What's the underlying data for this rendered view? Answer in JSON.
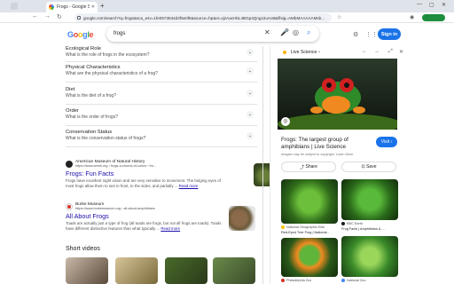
{
  "browser": {
    "tab_title": "Frogs - Google Search",
    "url": "google.com/search?q=frogs&sca_esv=1fe0573534d2f5e0f8&source=hp&ei=xjzAacHbL4BGp4Qngz2uAo8&iflsig=AMbMAAAAAMsb..."
  },
  "header": {
    "query": "frogs",
    "signin_label": "Sign in"
  },
  "paa": [
    {
      "title": "Ecological Role",
      "sub": "What is the role of frogs in the ecosystem?"
    },
    {
      "title": "Physical Characteristics",
      "sub": "What are the physical characteristics of a frog?"
    },
    {
      "title": "Diet",
      "sub": "What is the diet of a frog?"
    },
    {
      "title": "Order",
      "sub": "What is the order of frogs?"
    },
    {
      "title": "Conservation Status",
      "sub": "What is the conservation status of frogs?"
    }
  ],
  "results": [
    {
      "source": "American Museum of Natural History",
      "link": "https://www.amnh.org › frogs-a-chorus-of-colors › fro...",
      "title": "Frogs: Fun Facts",
      "snippet": "Frogs have excellent night vision and are very sensitive to movement. The bulging eyes of most frogs allow them to see in front, to the sides, and partially ...",
      "more": "Read more"
    },
    {
      "source": "Burke Museum",
      "link": "https://www.burkemuseum.org › all-about-amphibians",
      "title": "All About Frogs",
      "snippet": "Toads are actually just a type of frog (all toads are frogs, but not all frogs are toads). Toads have different distinctive features than what typically ...",
      "more": "Read more"
    }
  ],
  "short_videos_label": "Short videos",
  "panel": {
    "source_label": "Live Science",
    "caption": "Frogs: The largest group of amphibians | Live Science",
    "visit_label": "Visit",
    "copyright": "Images may be subject to copyright.  Learn More",
    "share_label": "Share",
    "save_label": "Save",
    "images": [
      {
        "source": "National Geographic Kids",
        "title": "Red-Eyed Tree Frog | National..."
      },
      {
        "source": "BBC Earth",
        "title": "Frog Facts | Amphibians & ..."
      },
      {
        "source": "Philadelphia Zoo",
        "title": "Red-Eyed Tree Frog"
      },
      {
        "source": "National Zoo",
        "title": "Red-Eyed Tree Frog"
      }
    ]
  },
  "colors": {
    "link": "#1a0dab",
    "accent": "#1a73e8"
  }
}
